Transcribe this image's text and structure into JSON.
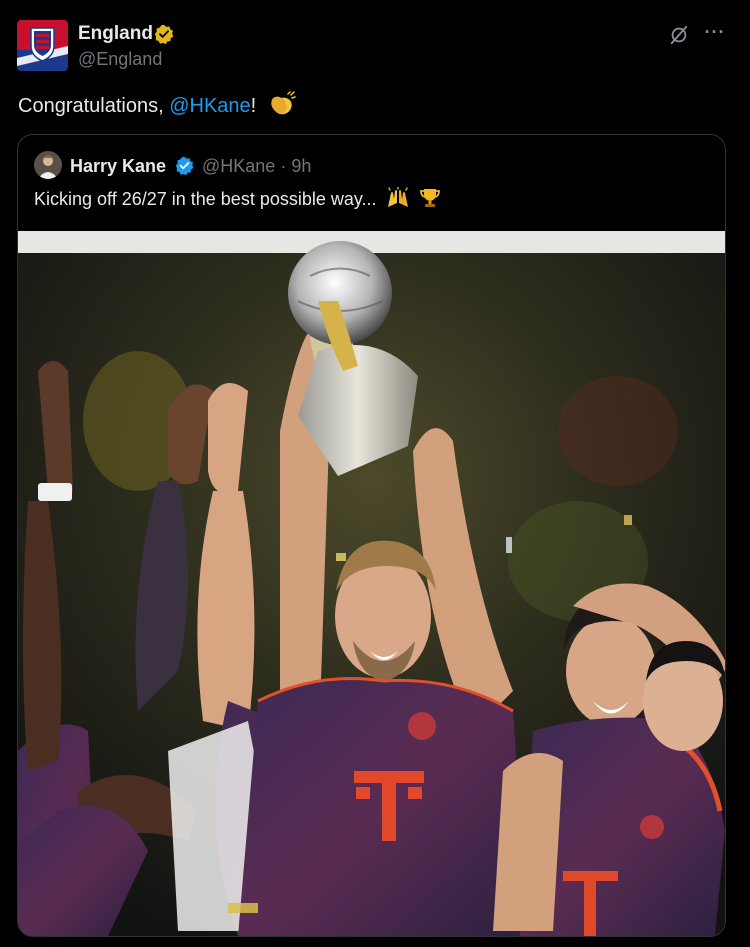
{
  "post": {
    "author": {
      "display_name": "England",
      "handle": "@England",
      "verified_badge": "gold-verified-icon",
      "avatar_icon": "three-lions-crest-icon"
    },
    "actions": {
      "grok_icon": "grok-icon",
      "more_label": "···"
    },
    "text_prefix": "Congratulations, ",
    "mention": "@HKane",
    "text_suffix": "!",
    "emoji": "clapping-hands-icon"
  },
  "quote": {
    "display_name": "Harry Kane",
    "handle": "@HKane",
    "separator": "·",
    "time": "9h",
    "text": "Kicking off 26/27 in the best possible way...",
    "emojis": [
      "raising-hands-icon",
      "trophy-icon"
    ],
    "verified_badge": "blue-verified-icon",
    "image_subject": "team-photo"
  },
  "colors": {
    "background": "#000000",
    "text": "#e7e9ea",
    "secondary_text": "#71767b",
    "link": "#1d9bf0",
    "border": "#2f3336",
    "gold_badge": "#e2b719",
    "blue_badge": "#1d9bf0"
  }
}
